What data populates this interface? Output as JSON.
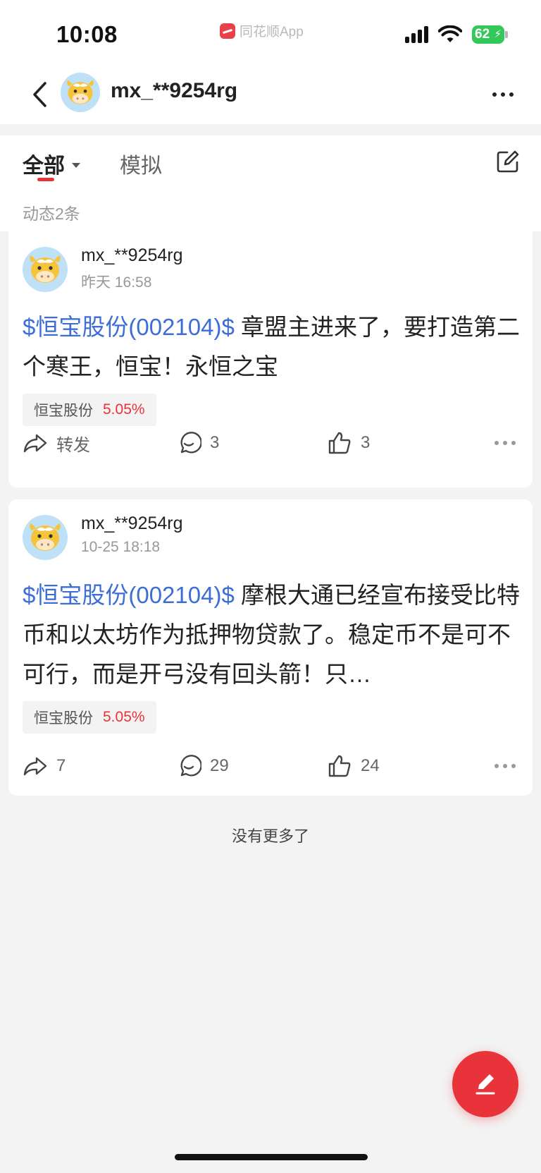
{
  "status_bar": {
    "time": "10:08",
    "back_app": "同花顺App",
    "battery": "62"
  },
  "header": {
    "username": "mx_**9254rg",
    "back_icon": "chevron-left-icon",
    "more_icon": "more-horizontal-icon"
  },
  "tabs": {
    "all_label": "全部",
    "sim_label": "模拟",
    "count_label": "动态2条"
  },
  "posts": [
    {
      "user": "mx_**9254rg",
      "time": "昨天 16:58",
      "stock_link": "$恒宝股份(002104)$",
      "text": " 章盟主进来了，要打造第二个寒王，恒宝！永恒之宝",
      "tag_name": "恒宝股份",
      "tag_change": "5.05%",
      "share_label": "转发",
      "comments": "3",
      "likes": "3"
    },
    {
      "user": "mx_**9254rg",
      "time": "10-25 18:18",
      "stock_link": "$恒宝股份(002104)$",
      "text": " 摩根大通已经宣布接受比特币和以太坊作为抵押物贷款了。稳定币不是可不可行，而是开弓没有回头箭！只…",
      "tag_name": "恒宝股份",
      "tag_change": "5.05%",
      "share_label": "7",
      "comments": "29",
      "likes": "24"
    }
  ],
  "footer": {
    "no_more": "没有更多了"
  },
  "colors": {
    "accent_red": "#e8333a",
    "link_blue": "#3d6ed6",
    "battery_green": "#34c759"
  }
}
